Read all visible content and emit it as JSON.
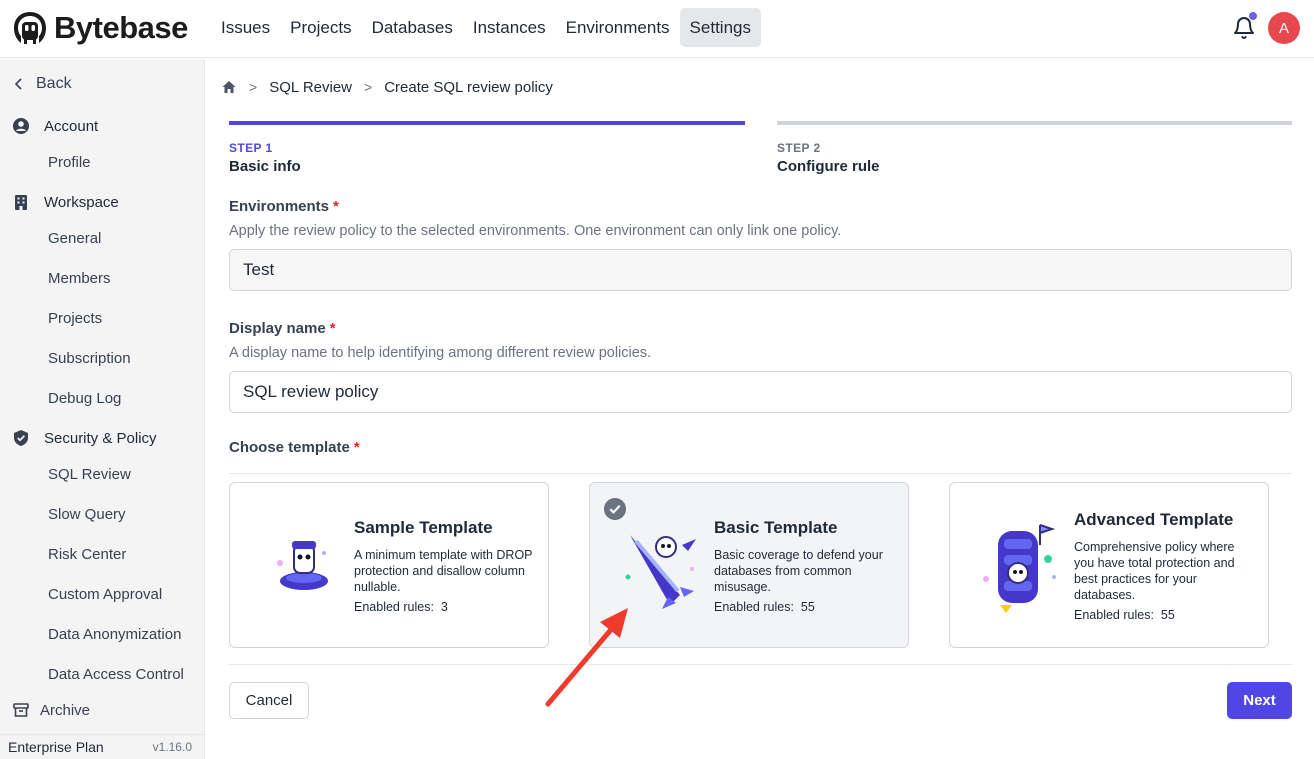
{
  "app": {
    "name": "Bytebase"
  },
  "nav": {
    "items": [
      "Issues",
      "Projects",
      "Databases",
      "Instances",
      "Environments",
      "Settings"
    ],
    "active": "Settings"
  },
  "user": {
    "initial": "A",
    "avatar_color": "#e5484d"
  },
  "sidebar": {
    "back": "Back",
    "account": {
      "label": "Account",
      "items": [
        "Profile"
      ]
    },
    "workspace": {
      "label": "Workspace",
      "items": [
        "General",
        "Members",
        "Projects",
        "Subscription",
        "Debug Log"
      ]
    },
    "security": {
      "label": "Security & Policy",
      "items": [
        "SQL Review",
        "Slow Query",
        "Risk Center",
        "Custom Approval",
        "Data Anonymization",
        "Data Access Control"
      ]
    },
    "archive": "Archive",
    "plan": "Enterprise Plan",
    "version": "v1.16.0"
  },
  "breadcrumb": {
    "items": [
      "SQL Review",
      "Create SQL review policy"
    ]
  },
  "steps": [
    {
      "num": "STEP 1",
      "title": "Basic info",
      "state": "current"
    },
    {
      "num": "STEP 2",
      "title": "Configure rule",
      "state": "upcoming"
    }
  ],
  "form": {
    "environments": {
      "label": "Environments",
      "help": "Apply the review policy to the selected environments. One environment can only link one policy.",
      "value": "Test"
    },
    "display_name": {
      "label": "Display name",
      "help": "A display name to help identifying among different review policies.",
      "value": "SQL review policy"
    },
    "template": {
      "label": "Choose template",
      "rules_label": "Enabled rules:",
      "options": [
        {
          "title": "Sample Template",
          "description": "A minimum template with DROP protection and disallow column nullable.",
          "rules": "3",
          "selected": false
        },
        {
          "title": "Basic Template",
          "description": "Basic coverage to defend your databases from common misusage.",
          "rules": "55",
          "selected": true
        },
        {
          "title": "Advanced Template",
          "description": "Comprehensive policy where you have total protection and best practices for your databases.",
          "rules": "55",
          "selected": false
        }
      ]
    }
  },
  "actions": {
    "cancel": "Cancel",
    "next": "Next"
  },
  "colors": {
    "accent": "#4f46e5",
    "required": "#dc2626",
    "annotation_arrow": "#ef3b2c"
  },
  "icons": [
    "bytebase-logo-icon",
    "bell-icon",
    "chevron-left-icon",
    "account-icon",
    "workspace-icon",
    "shield-icon",
    "archive-icon",
    "home-icon",
    "check-icon"
  ]
}
